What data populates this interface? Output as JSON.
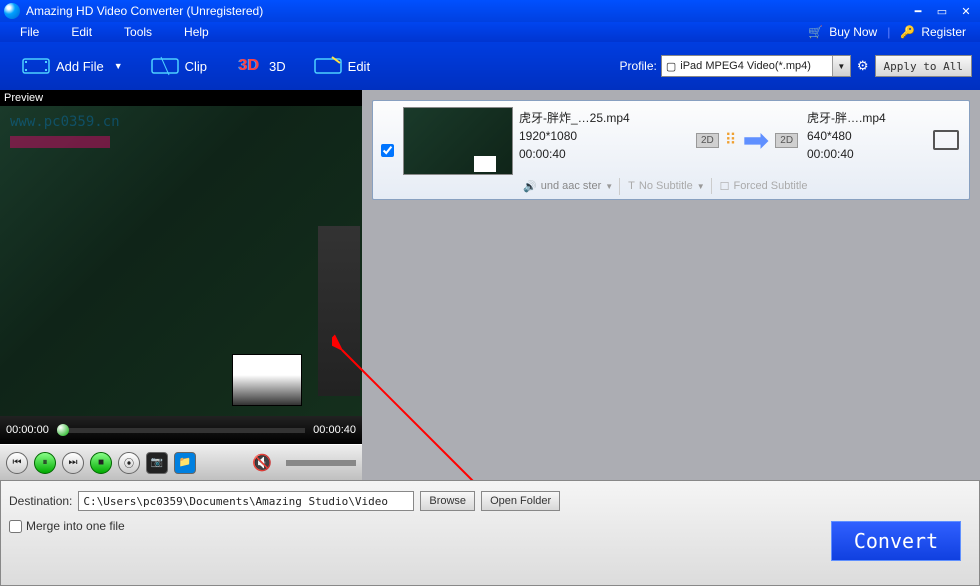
{
  "title": "Amazing HD Video Converter (Unregistered)",
  "menu": {
    "file": "File",
    "edit": "Edit",
    "tools": "Tools",
    "help": "Help"
  },
  "top": {
    "buy": "Buy Now",
    "register": "Register"
  },
  "toolbar": {
    "add_file": "Add File",
    "clip": "Clip",
    "td": "3D",
    "edit": "Edit",
    "profile_label": "Profile:",
    "profile_value": "iPad MPEG4 Video(*.mp4)",
    "apply": "Apply to All"
  },
  "watermark": "www.pc0359.cn",
  "preview": {
    "label": "Preview",
    "time_start": "00:00:00",
    "time_end": "00:00:40"
  },
  "item": {
    "filename": "虎牙-胖炸_…25.mp4",
    "resolution_in": "1920*1080",
    "duration_in": "00:00:40",
    "filename_out": "虎牙-胖….mp4",
    "resolution_out": "640*480",
    "duration_out": "00:00:40",
    "badge": "2D",
    "audio": "und aac ster",
    "subtitle": "No Subtitle",
    "forced": "Forced Subtitle"
  },
  "bottom": {
    "dest_label": "Destination:",
    "dest_value": "C:\\Users\\pc0359\\Documents\\Amazing Studio\\Video",
    "browse": "Browse",
    "open": "Open Folder",
    "merge": "Merge into one file",
    "convert": "Convert"
  }
}
